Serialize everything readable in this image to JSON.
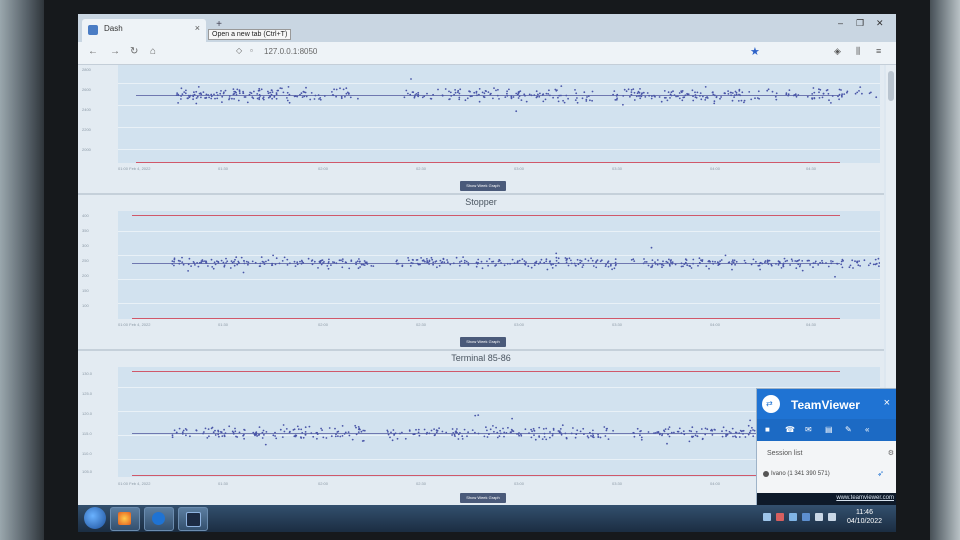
{
  "browser": {
    "tab_title": "Dash",
    "tab_close": "×",
    "new_tab": "+",
    "tooltip": "Open a new tab (Ctrl+T)",
    "window_controls": [
      "–",
      "❐",
      "✕"
    ],
    "url": "127.0.0.1:8050",
    "nav": {
      "back": "←",
      "forward": "→",
      "reload": "↻",
      "home": "⌂"
    }
  },
  "panels": [
    {
      "title": "",
      "y_ticks": [
        "2800",
        "2600",
        "2400",
        "2200",
        "2000",
        "1800"
      ],
      "x_ticks": [
        "01:00\nFeb 4, 2022",
        "01:30",
        "02:00",
        "02:30",
        "03:00",
        "03:30",
        "04:00",
        "04:30"
      ],
      "button": "Show Week Graph"
    },
    {
      "title": "Stopper",
      "y_ticks": [
        "400",
        "350",
        "300",
        "250",
        "200",
        "150",
        "100"
      ],
      "x_ticks": [
        "01:00\nFeb 4, 2022",
        "01:30",
        "02:00",
        "02:30",
        "03:00",
        "03:30",
        "04:00",
        "04:30"
      ],
      "button": "Show Week Graph"
    },
    {
      "title": "Terminal 85-86",
      "y_ticks": [
        "130.0",
        "125.0",
        "120.0",
        "115.0",
        "110.0",
        "105.0"
      ],
      "x_ticks": [
        "01:00\nFeb 4, 2022",
        "01:30",
        "02:00",
        "02:30",
        "03:00",
        "03:30",
        "04:00",
        "04:30"
      ],
      "button": "Show Week Graph"
    }
  ],
  "teamviewer": {
    "name": "TeamViewer",
    "close": "×",
    "tools": [
      "video-icon",
      "call-icon",
      "chat-icon",
      "files-icon",
      "pen-icon",
      "collapse-icon"
    ],
    "session_list": "Session list",
    "session_entry": "Ivano (1 341 390 571)",
    "link": "www.teamviewer.com"
  },
  "taskbar": {
    "time": "11:46",
    "date": "04/10/2022"
  },
  "colors": {
    "accent": "#1f73d3",
    "limit_line": "#d0586a",
    "points": "#4a56a8"
  }
}
